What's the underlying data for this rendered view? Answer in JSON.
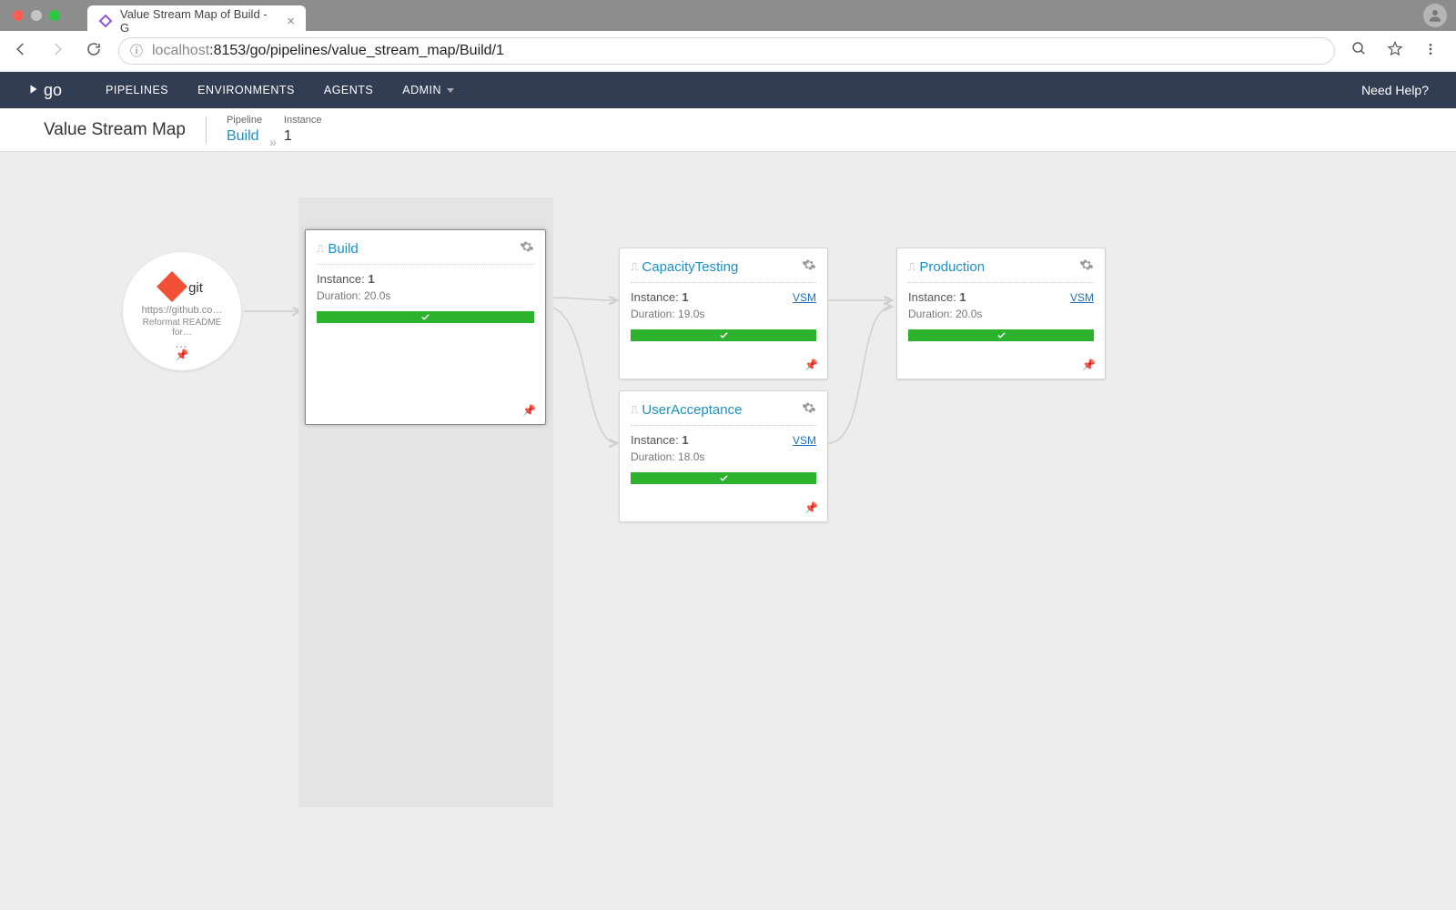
{
  "browser": {
    "tab_title": "Value Stream Map of Build - G",
    "url_host": "localhost",
    "url_path": ":8153/go/pipelines/value_stream_map/Build/1"
  },
  "nav": {
    "logo": "go",
    "items": [
      "PIPELINES",
      "ENVIRONMENTS",
      "AGENTS",
      "ADMIN"
    ],
    "help": "Need Help?"
  },
  "header": {
    "title": "Value Stream Map",
    "pipeline_label": "Pipeline",
    "pipeline_name": "Build",
    "instance_label": "Instance",
    "instance_value": "1"
  },
  "git": {
    "label": "git",
    "url": "https://github.co…",
    "msg": "Reformat README for…",
    "dots": "…"
  },
  "labels": {
    "instance_prefix": "Instance:",
    "duration_prefix": "Duration:",
    "vsm": "VSM"
  },
  "nodes": {
    "build": {
      "name": "Build",
      "instance": "1",
      "duration": "20.0s"
    },
    "capacity": {
      "name": "CapacityTesting",
      "instance": "1",
      "duration": "19.0s"
    },
    "useraccept": {
      "name": "UserAcceptance",
      "instance": "1",
      "duration": "18.0s"
    },
    "production": {
      "name": "Production",
      "instance": "1",
      "duration": "20.0s"
    }
  }
}
